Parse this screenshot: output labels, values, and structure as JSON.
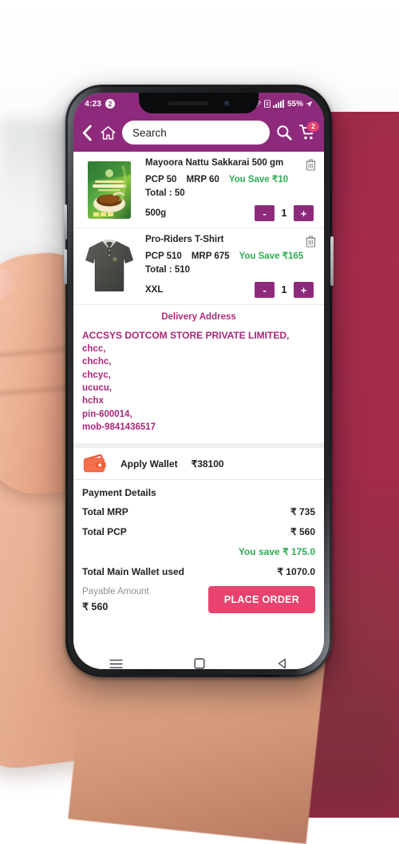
{
  "status_bar": {
    "time": "4:23",
    "notif_count": "2",
    "battery": "55%",
    "wifi_icon": "wifi-icon",
    "signal_icon": "signal-bars-icon",
    "sim_icon": "sim-icon",
    "location_icon": "location-arrow-icon"
  },
  "app_bar": {
    "back_icon": "back-chevron-icon",
    "home_icon": "home-icon",
    "search_placeholder": "Search",
    "search_value": "",
    "search_icon": "search-icon",
    "cart_icon": "cart-icon",
    "cart_badge": "2"
  },
  "cart": {
    "items": [
      {
        "name": "Mayoora Nattu Sakkarai 500 gm",
        "pcp": "PCP 50",
        "mrp": "MRP 60",
        "save": "You Save ₹10",
        "total": "Total : 50",
        "variant": "500g",
        "qty": "1",
        "minus": "-",
        "plus": "+",
        "delete_icon": "trash-icon",
        "image": "sugar-packet-image"
      },
      {
        "name": "Pro-Riders T-Shirt",
        "pcp": "PCP 510",
        "mrp": "MRP 675",
        "save": "You Save ₹165",
        "total": "Total : 510",
        "variant": "XXL",
        "qty": "1",
        "minus": "-",
        "plus": "+",
        "delete_icon": "trash-icon",
        "image": "tshirt-image"
      }
    ]
  },
  "delivery_address": {
    "title": "Delivery Address",
    "lines": [
      "ACCSYS DOTCOM STORE PRIVATE LIMITED,",
      "chcc,",
      "chchc,",
      "chcyc,",
      "ucucu,",
      "hchx",
      "pin-600014,",
      "mob-9841436517"
    ]
  },
  "wallet": {
    "icon": "wallet-icon",
    "label": "Apply Wallet",
    "amount": "₹38100"
  },
  "payment": {
    "heading": "Payment Details",
    "rows": [
      {
        "label": "Total MRP",
        "value": "₹ 735"
      },
      {
        "label": "Total PCP",
        "value": "₹ 560"
      }
    ],
    "you_save": "You save ₹ 175.0",
    "wallet_used_label": "Total Main Wallet used",
    "wallet_used_value": "₹ 1070.0",
    "payable_label": "Payable Amount",
    "payable_value": "₹ 560",
    "place_order": "PLACE ORDER"
  },
  "nav_bar": {
    "recents_icon": "recents-menu-icon",
    "home_icon": "home-square-icon",
    "back_icon": "back-triangle-icon"
  },
  "colors": {
    "brand_purple": "#8e2a7c",
    "accent_pink": "#e8436f",
    "save_green": "#2eaa53",
    "address_magenta": "#a8277a",
    "wallet_orange": "#f0603c",
    "background_crimson": "#a32c4c"
  }
}
